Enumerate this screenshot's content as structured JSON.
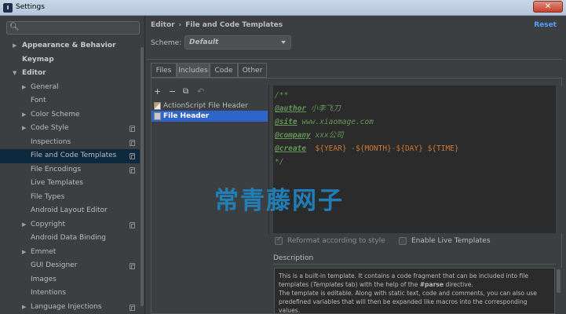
{
  "window": {
    "title": "Settings",
    "close_symbol": "✕",
    "app_icon_letter": "I"
  },
  "search": {
    "value": "",
    "placeholder": ""
  },
  "sidebar": {
    "items": [
      {
        "label": "Appearance & Behavior",
        "level": 0,
        "arrow": "▶",
        "bold": true,
        "copy": false,
        "selected": false
      },
      {
        "label": "Keymap",
        "level": 0,
        "arrow": "",
        "bold": true,
        "copy": false,
        "selected": false
      },
      {
        "label": "Editor",
        "level": 0,
        "arrow": "▼",
        "bold": true,
        "copy": false,
        "selected": false
      },
      {
        "label": "General",
        "level": 1,
        "arrow": "▶",
        "bold": false,
        "copy": false,
        "selected": false
      },
      {
        "label": "Font",
        "level": 1,
        "arrow": "",
        "bold": false,
        "copy": false,
        "selected": false
      },
      {
        "label": "Color Scheme",
        "level": 1,
        "arrow": "▶",
        "bold": false,
        "copy": false,
        "selected": false
      },
      {
        "label": "Code Style",
        "level": 1,
        "arrow": "▶",
        "bold": false,
        "copy": true,
        "selected": false
      },
      {
        "label": "Inspections",
        "level": 1,
        "arrow": "",
        "bold": false,
        "copy": true,
        "selected": false
      },
      {
        "label": "File and Code Templates",
        "level": 1,
        "arrow": "",
        "bold": false,
        "copy": true,
        "selected": true
      },
      {
        "label": "File Encodings",
        "level": 1,
        "arrow": "",
        "bold": false,
        "copy": true,
        "selected": false
      },
      {
        "label": "Live Templates",
        "level": 1,
        "arrow": "",
        "bold": false,
        "copy": false,
        "selected": false
      },
      {
        "label": "File Types",
        "level": 1,
        "arrow": "",
        "bold": false,
        "copy": false,
        "selected": false
      },
      {
        "label": "Android Layout Editor",
        "level": 1,
        "arrow": "",
        "bold": false,
        "copy": false,
        "selected": false
      },
      {
        "label": "Copyright",
        "level": 1,
        "arrow": "▶",
        "bold": false,
        "copy": true,
        "selected": false
      },
      {
        "label": "Android Data Binding",
        "level": 1,
        "arrow": "",
        "bold": false,
        "copy": false,
        "selected": false
      },
      {
        "label": "Emmet",
        "level": 1,
        "arrow": "▶",
        "bold": false,
        "copy": false,
        "selected": false
      },
      {
        "label": "GUI Designer",
        "level": 1,
        "arrow": "",
        "bold": false,
        "copy": true,
        "selected": false
      },
      {
        "label": "Images",
        "level": 1,
        "arrow": "",
        "bold": false,
        "copy": false,
        "selected": false
      },
      {
        "label": "Intentions",
        "level": 1,
        "arrow": "",
        "bold": false,
        "copy": false,
        "selected": false
      },
      {
        "label": "Language Injections",
        "level": 1,
        "arrow": "▶",
        "bold": false,
        "copy": true,
        "selected": false
      }
    ]
  },
  "header": {
    "breadcrumb_parent": "Editor",
    "breadcrumb_sep": "›",
    "breadcrumb_current": "File and Code Templates",
    "reset_label": "Reset"
  },
  "scheme": {
    "label": "Scheme:",
    "value": "Default"
  },
  "tabs": [
    {
      "label": "Files",
      "active": false
    },
    {
      "label": "Includes",
      "active": true
    },
    {
      "label": "Code",
      "active": false
    },
    {
      "label": "Other",
      "active": false
    }
  ],
  "toolbar": {
    "add": "+",
    "remove": "−",
    "copy": "⧉",
    "reset": "↶"
  },
  "files": [
    {
      "name": "ActionScript File Header",
      "icon": "actionscript-file-icon",
      "selected": false
    },
    {
      "name": "File Header",
      "icon": "file-icon",
      "selected": true
    }
  ],
  "editor": {
    "open_comment": "/**",
    "lines": [
      {
        "tag": "@author",
        "value": " 小李飞刀"
      },
      {
        "tag": "@site",
        "value": " www.xiaomage.com"
      },
      {
        "tag": "@company",
        "value": " xxx公司"
      }
    ],
    "create": {
      "tag": "@create",
      "vars": [
        "${YEAR}",
        "${MONTH}",
        "${DAY}",
        "${TIME}"
      ],
      "separators": [
        " -",
        "-",
        " "
      ]
    },
    "close_comment": "*/"
  },
  "watermark": "常青藤网子",
  "options": {
    "reformat_label": "Reformat according to style",
    "live_templates_label": "Enable Live Templates"
  },
  "description": {
    "title": "Description",
    "text_1": "This is a built-in template. It contains a code fragment that can be included into file templates (",
    "text_1_em": "Templates",
    "text_1b": " tab) with the help of the ",
    "text_1_bold": "#parse",
    "text_1c": " directive.",
    "text_2": "The template is editable. Along with static text, code and comments, you can also use predefined variables that will then be expanded like macros into the corresponding values."
  },
  "colors": {
    "background": "#3c3f41",
    "editor_bg": "#2b2b2b",
    "selection": "#2f65ca",
    "sidebar_selection": "#0d293e",
    "link": "#589df6",
    "doc_comment": "#629755",
    "variable": "#e8bf6a"
  }
}
